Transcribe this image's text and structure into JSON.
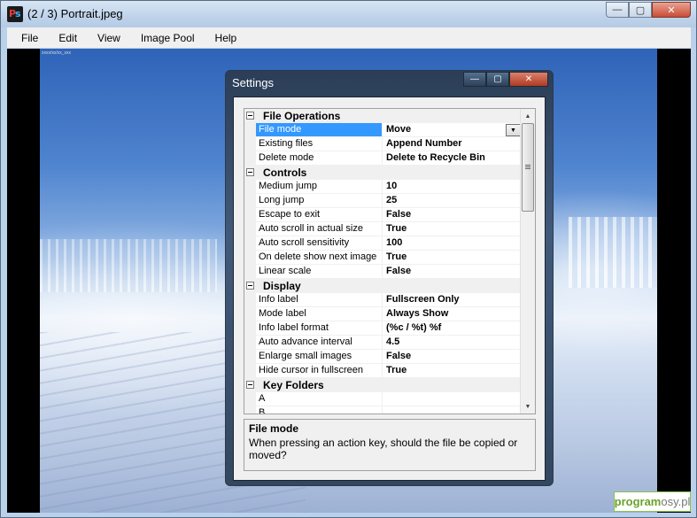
{
  "window": {
    "title": "(2 / 3) Portrait.jpeg",
    "icon": "ps-app-icon",
    "icon_letters": [
      "P",
      "s"
    ],
    "controls": {
      "minimize": "—",
      "maximize": "▢",
      "close": "✕"
    }
  },
  "menu": {
    "items": [
      "File",
      "Edit",
      "View",
      "Image Pool",
      "Help"
    ]
  },
  "image": {
    "info_label": "xxxx/xx/xx_xxx"
  },
  "watermark": {
    "part1": "program",
    "part2": "osy.pl"
  },
  "dialog": {
    "title": "Settings",
    "controls": {
      "minimize": "—",
      "maximize": "▢",
      "close": "✕"
    },
    "categories": [
      {
        "name": "File Operations",
        "properties": [
          {
            "name": "File mode",
            "value": "Move",
            "selected": true,
            "dropdown": true
          },
          {
            "name": "Existing files",
            "value": "Append Number"
          },
          {
            "name": "Delete mode",
            "value": "Delete to Recycle Bin"
          }
        ]
      },
      {
        "name": "Controls",
        "properties": [
          {
            "name": "Medium jump",
            "value": "10"
          },
          {
            "name": "Long jump",
            "value": "25"
          },
          {
            "name": "Escape to exit",
            "value": "False"
          },
          {
            "name": "Auto scroll in actual size",
            "value": "True"
          },
          {
            "name": "Auto scroll sensitivity",
            "value": "100"
          },
          {
            "name": "On delete show next image",
            "value": "True"
          },
          {
            "name": "Linear scale",
            "value": "False"
          }
        ]
      },
      {
        "name": "Display",
        "properties": [
          {
            "name": "Info label",
            "value": "Fullscreen Only"
          },
          {
            "name": "Mode label",
            "value": "Always Show"
          },
          {
            "name": "Info label format",
            "value": "(%c / %t) %f"
          },
          {
            "name": "Auto advance interval",
            "value": "4.5"
          },
          {
            "name": "Enlarge small images",
            "value": "False"
          },
          {
            "name": "Hide cursor in fullscreen",
            "value": "True"
          }
        ]
      },
      {
        "name": "Key Folders",
        "properties": [
          {
            "name": "A",
            "value": ""
          },
          {
            "name": "B",
            "value": ""
          }
        ]
      }
    ],
    "help": {
      "title": "File mode",
      "description": "When pressing an action key, should the file be copied or moved?"
    }
  }
}
